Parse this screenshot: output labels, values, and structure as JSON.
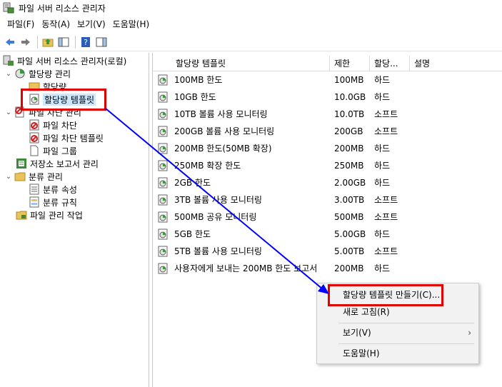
{
  "window": {
    "title": "파일 서버 리소스 관리자"
  },
  "menu": [
    "파일(F)",
    "동작(A)",
    "보기(V)",
    "도움말(H)"
  ],
  "toolbar": {
    "buttons": [
      "back-icon",
      "forward-icon",
      "up-folder-icon",
      "show-hide-pane-icon",
      "help-icon",
      "action-pane-icon"
    ]
  },
  "tree": {
    "root": "파일 서버 리소스 관리자(로컬)",
    "quota_management": "할당량 관리",
    "quotas": "할당량",
    "quota_templates": "할당량 템플릿",
    "file_screening_management": "파일 차단 관리",
    "file_screens": "파일 차단",
    "file_screen_templates": "파일 차단 템플릿",
    "file_groups": "파일 그룹",
    "storage_reports": "저장소 보고서 관리",
    "classification_management": "분류 관리",
    "classification_properties": "분류 속성",
    "classification_rules": "분류 규칙",
    "file_management_tasks": "파일 관리 작업"
  },
  "list": {
    "columns": [
      "할당량 템플릿",
      "제한",
      "할당...",
      "설명"
    ],
    "rows": [
      {
        "name": "100MB 한도",
        "limit": "100MB",
        "type": "하드"
      },
      {
        "name": "10GB 한도",
        "limit": "10.0GB",
        "type": "하드"
      },
      {
        "name": "10TB 볼륨 사용 모니터링",
        "limit": "10.0TB",
        "type": "소프트"
      },
      {
        "name": "200GB 볼륨 사용 모니터링",
        "limit": "200GB",
        "type": "소프트"
      },
      {
        "name": "200MB 한도(50MB 확장)",
        "limit": "200MB",
        "type": "하드"
      },
      {
        "name": "250MB 확장 한도",
        "limit": "250MB",
        "type": "하드"
      },
      {
        "name": "2GB 한도",
        "limit": "2.00GB",
        "type": "하드"
      },
      {
        "name": "3TB 볼륨 사용 모니터링",
        "limit": "3.00TB",
        "type": "소프트"
      },
      {
        "name": "500MB 공유 모니터링",
        "limit": "500MB",
        "type": "소프트"
      },
      {
        "name": "5GB 한도",
        "limit": "5.00GB",
        "type": "하드"
      },
      {
        "name": "5TB 볼륨 사용 모니터링",
        "limit": "5.00TB",
        "type": "소프트"
      },
      {
        "name": "사용자에게 보내는 200MB 한도 보고서",
        "limit": "200MB",
        "type": "하드"
      }
    ]
  },
  "context_menu": {
    "create_template": "할당량 템플릿 만들기(C)...",
    "refresh": "새로 고침(R)",
    "view": "보기(V)",
    "help": "도움말(H)"
  },
  "colors": {
    "highlight": "#e00000",
    "arrow": "#0000ff",
    "selection": "#cce8ff"
  }
}
